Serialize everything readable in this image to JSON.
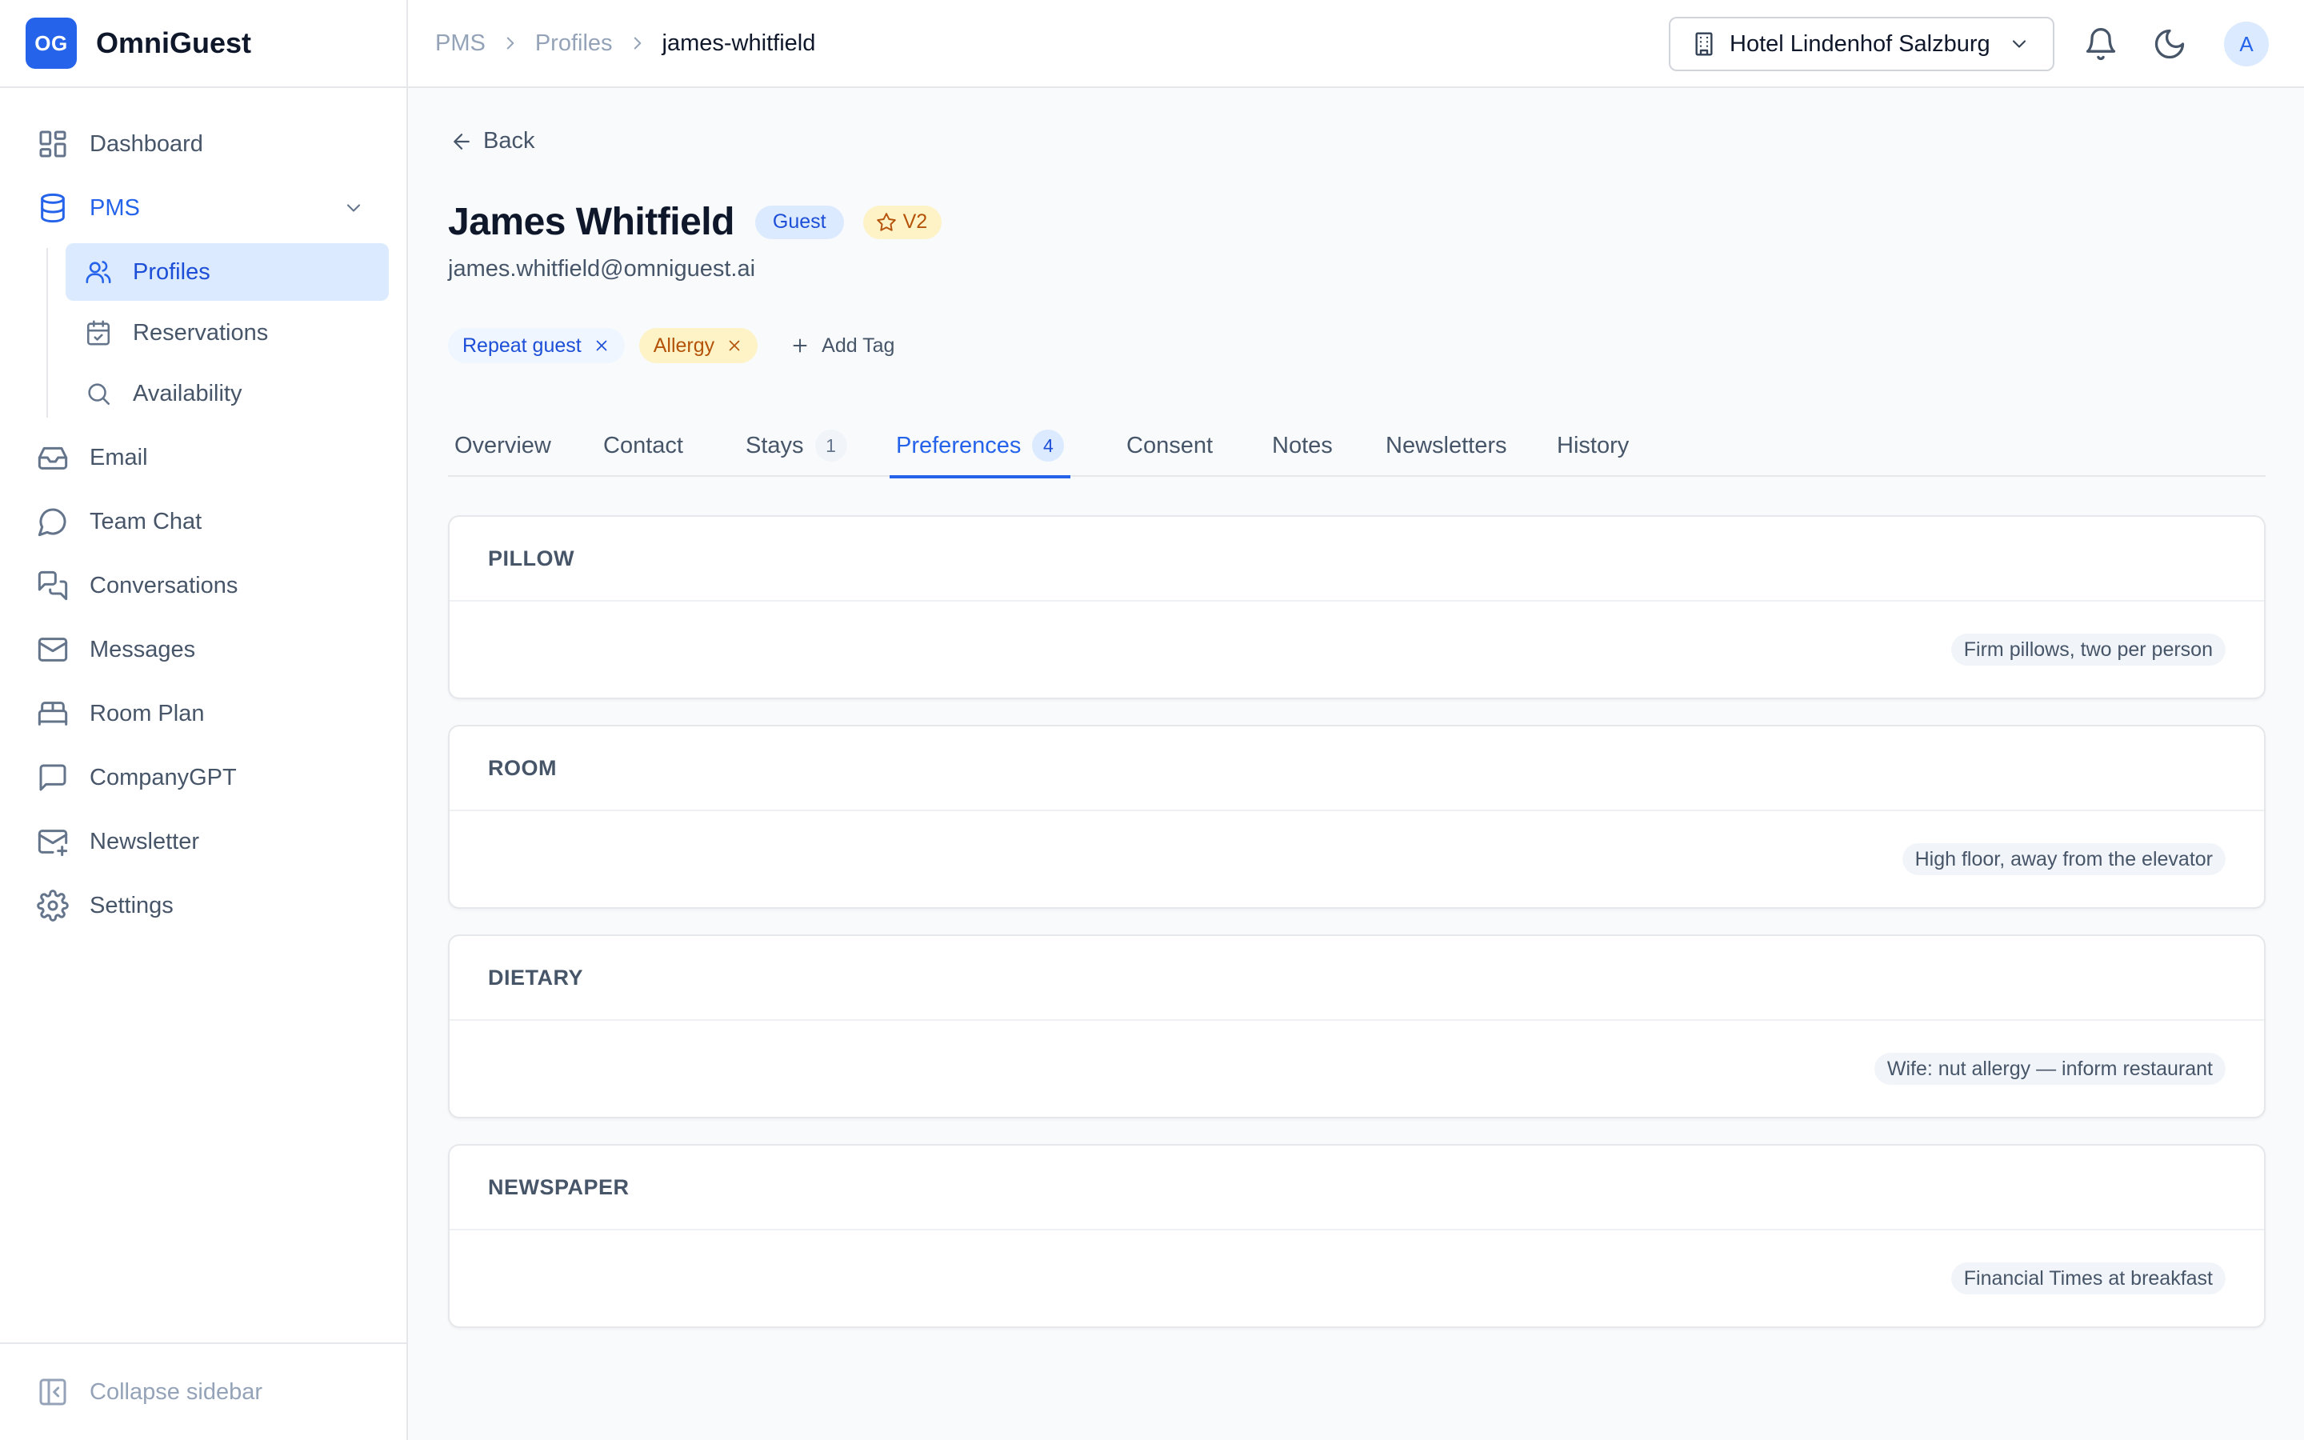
{
  "brand": {
    "logo": "OG",
    "name": "OmniGuest"
  },
  "colors": {
    "primary": "#2563eb",
    "primary_light": "#dbeafe",
    "amber": "#b45309",
    "amber_light": "#fef3c7"
  },
  "sidebar": {
    "items": [
      {
        "label": "Dashboard",
        "icon": "dashboard-icon"
      },
      {
        "label": "PMS",
        "icon": "database-icon",
        "expanded": true
      },
      {
        "label": "Email",
        "icon": "inbox-icon"
      },
      {
        "label": "Team Chat",
        "icon": "chat-bubble-icon"
      },
      {
        "label": "Conversations",
        "icon": "conversations-icon"
      },
      {
        "label": "Messages",
        "icon": "mail-icon"
      },
      {
        "label": "Room Plan",
        "icon": "bed-icon"
      },
      {
        "label": "CompanyGPT",
        "icon": "message-square-icon"
      },
      {
        "label": "Newsletter",
        "icon": "newsletter-icon"
      },
      {
        "label": "Settings",
        "icon": "gear-icon"
      }
    ],
    "pms_children": [
      {
        "label": "Profiles",
        "icon": "users-icon",
        "active": true
      },
      {
        "label": "Reservations",
        "icon": "calendar-check-icon"
      },
      {
        "label": "Availability",
        "icon": "search-icon"
      }
    ],
    "collapse_label": "Collapse sidebar"
  },
  "header": {
    "breadcrumb": [
      "PMS",
      "Profiles",
      "james-whitfield"
    ],
    "hotel": "Hotel Lindenhof Salzburg",
    "avatar_initial": "A"
  },
  "profile": {
    "back_label": "Back",
    "name": "James Whitfield",
    "type_badge": "Guest",
    "vip_badge": "V2",
    "email": "james.whitfield@omniguest.ai",
    "tags": [
      "Repeat guest",
      "Allergy"
    ],
    "add_tag_label": "Add Tag"
  },
  "tabs": [
    {
      "label": "Overview"
    },
    {
      "label": "Contact"
    },
    {
      "label": "Stays",
      "count": "1"
    },
    {
      "label": "Preferences",
      "count": "4",
      "active": true
    },
    {
      "label": "Consent"
    },
    {
      "label": "Notes"
    },
    {
      "label": "Newsletters"
    },
    {
      "label": "History"
    }
  ],
  "preferences": [
    {
      "category": "PILLOW",
      "value": "Firm pillows, two per person"
    },
    {
      "category": "ROOM",
      "value": "High floor, away from the elevator"
    },
    {
      "category": "DIETARY",
      "value": "Wife: nut allergy — inform restaurant"
    },
    {
      "category": "NEWSPAPER",
      "value": "Financial Times at breakfast"
    }
  ]
}
